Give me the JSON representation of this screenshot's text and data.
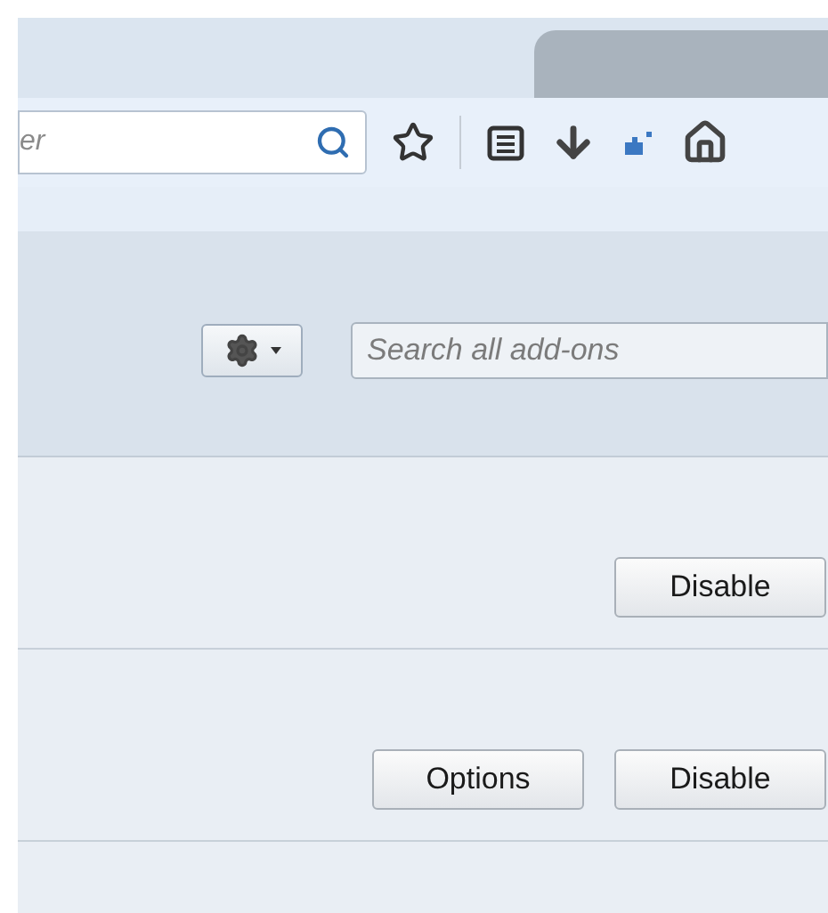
{
  "toolbar": {
    "search": {
      "placeholder": "er"
    }
  },
  "header": {
    "search": {
      "placeholder": "Search all add-ons"
    }
  },
  "addons": [
    {
      "buttons": [
        "Disable"
      ]
    },
    {
      "buttons": [
        "Options",
        "Disable"
      ]
    }
  ]
}
